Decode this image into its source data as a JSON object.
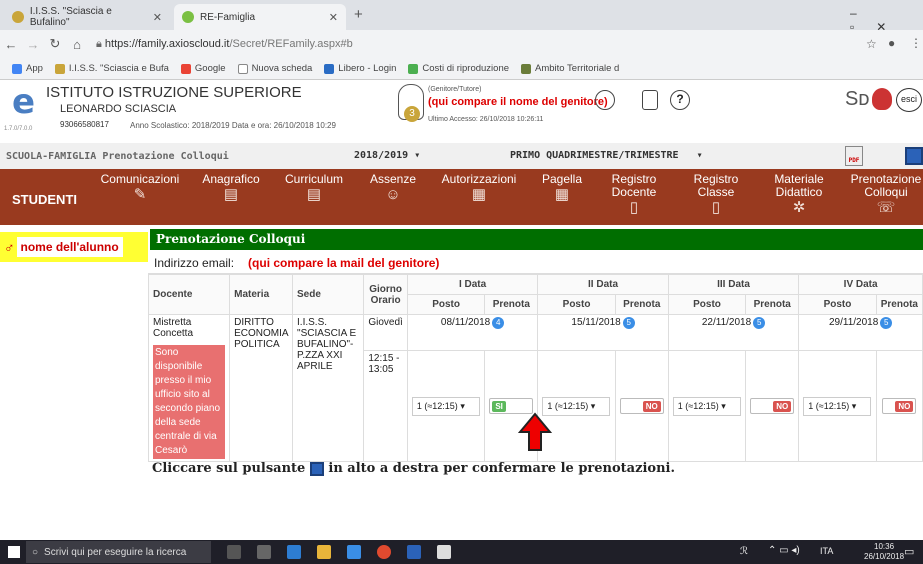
{
  "browser": {
    "tabs": [
      {
        "label": "I.I.S.S. \"Sciascia e Bufalino\""
      },
      {
        "label": "RE-Famiglia"
      }
    ],
    "new_tab": "+",
    "url_host": "https://family.axioscloud.it",
    "url_path": "/Secret/REFamily.aspx#b",
    "bookmarks": [
      "App",
      "I.I.S.S. \"Sciascia e Bufa",
      "Google",
      "Nuova scheda",
      "Libero - Login",
      "Costi di riproduzione",
      "Ambito Territoriale d"
    ]
  },
  "header": {
    "school_title": "ISTITUTO ISTRUZIONE SUPERIORE",
    "school_name": "LEONARDO SCIASCIA",
    "code": "93066580817",
    "version": "1.7.0/7.0.0",
    "year_info": "Anno Scolastico: 2018/2019   Data e ora: 26/10/2018 10:29",
    "guardian_role": "(Genitore/Tutore)",
    "guardian_name": "(qui compare il nome del genitore)",
    "last_access": "Ultimo Accesso: 26/10/2018 10:26:11",
    "avatar_num": "3",
    "esci": "esci"
  },
  "schoolbar": {
    "title": "SCUOLA-FAMIGLIA Prenotazione Colloqui",
    "year": "2018/2019",
    "period": "PRIMO QUADRIMESTRE/TRIMESTRE"
  },
  "menu": {
    "students": "STUDENTI",
    "items": [
      {
        "label": "Comunicazioni",
        "icon": "megaphone-icon"
      },
      {
        "label": "Anagrafico",
        "icon": "document-icon"
      },
      {
        "label": "Curriculum",
        "icon": "document-icon"
      },
      {
        "label": "Assenze",
        "icon": "smiley-icon"
      },
      {
        "label": "Autorizzazioni",
        "icon": "calendar-icon"
      },
      {
        "label": "Pagella",
        "icon": "report-icon"
      },
      {
        "label": "Registro\nDocente",
        "icon": "book-icon"
      },
      {
        "label": "Registro\nClasse",
        "icon": "book-icon"
      },
      {
        "label": "Materiale\nDidattico",
        "icon": "material-icon"
      },
      {
        "label": "Prenotazione\nColloqui",
        "icon": "talk-icon"
      }
    ]
  },
  "student": {
    "gender_icon": "♂",
    "name": "nome dell'alunno"
  },
  "section_title": "Prenotazione Colloqui",
  "email": {
    "label": "Indirizzo email:",
    "value": "(qui compare la mail del genitore)"
  },
  "table": {
    "headers": {
      "docente": "Docente",
      "materia": "Materia",
      "sede": "Sede",
      "giorno": "Giorno Orario",
      "posto": "Posto",
      "prenota": "Prenota"
    },
    "data_labels": [
      "I Data",
      "II Data",
      "III Data",
      "IV Data"
    ],
    "row": {
      "docente": "Mistretta Concetta",
      "note": "Sono disponibile presso il mio ufficio sito al secondo piano della sede centrale di via Cesarò",
      "materia": "DIRITTO ECONOMIA POLITICA",
      "sede": "I.I.S.S. \"SCIASCIA E BUFALINO\"- P.ZZA XXI APRILE",
      "giorno": "Giovedì",
      "orario": "12:15 - 13:05",
      "dates": [
        {
          "date": "08/11/2018",
          "count": "4",
          "posto": "1 (≈12:15)",
          "prenota": "SI",
          "on": true
        },
        {
          "date": "15/11/2018",
          "count": "5",
          "posto": "1 (≈12:15)",
          "prenota": "NO",
          "on": false
        },
        {
          "date": "22/11/2018",
          "count": "5",
          "posto": "1 (≈12:15)",
          "prenota": "NO",
          "on": false
        },
        {
          "date": "29/11/2018",
          "count": "5",
          "posto": "1 (≈12:15)",
          "prenota": "NO",
          "on": false
        }
      ]
    }
  },
  "instruction_pre": "Cliccare sul pulsante",
  "instruction_post": "in alto a destra per confermare le prenotazioni.",
  "taskbar": {
    "search": "Scrivi qui per eseguire la ricerca",
    "lang": "ITA",
    "time": "10:36",
    "date": "26/10/2018"
  },
  "colors": {
    "menu": "#993a1f",
    "green": "#006e00",
    "note": "#e87070",
    "yellow": "#ffff33"
  }
}
